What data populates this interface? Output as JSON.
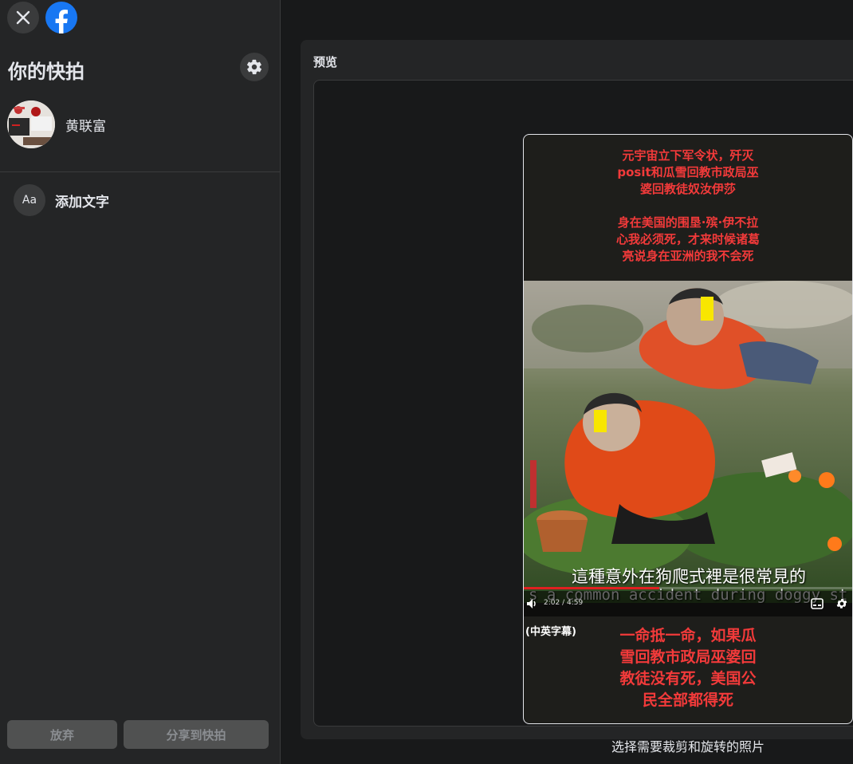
{
  "sidebar": {
    "title": "你的快拍",
    "profile": {
      "name": "黄联富"
    },
    "add_text": {
      "icon_text": "Aa",
      "label": "添加文字"
    },
    "buttons": {
      "discard": "放弃",
      "share": "分享到快拍"
    }
  },
  "preview": {
    "label": "预览",
    "helper_text": "选择需要裁剪和旋转的照片",
    "story": {
      "caption_top_lines": [
        "元宇宙立下军令状，歼灭",
        "posit和瓜雪回教市政局巫",
        "婆回教徒奴汝伊莎",
        "",
        "身在美国的围垦·殡·伊不拉",
        "心我必须死，才来时候诸葛",
        "亮说身在亚洲的我不会死"
      ],
      "subtitle_cn": "這種意外在狗爬式裡是很常見的",
      "subtitle_en": "s a common accident during doggy st",
      "video_time": "2:02 / 4:59",
      "video_progress": 0.41,
      "subtitle_tag": "(中英字幕)",
      "caption_bottom_lines": [
        "一命抵一命，如果瓜",
        "雪回教市政局巫婆回",
        "教徒没有死，美国公",
        "民全部都得死"
      ]
    }
  },
  "colors": {
    "caption_red": "#f23a3a",
    "facebook_blue": "#1877f2",
    "panel_bg": "#242526",
    "app_bg": "#18191a"
  }
}
